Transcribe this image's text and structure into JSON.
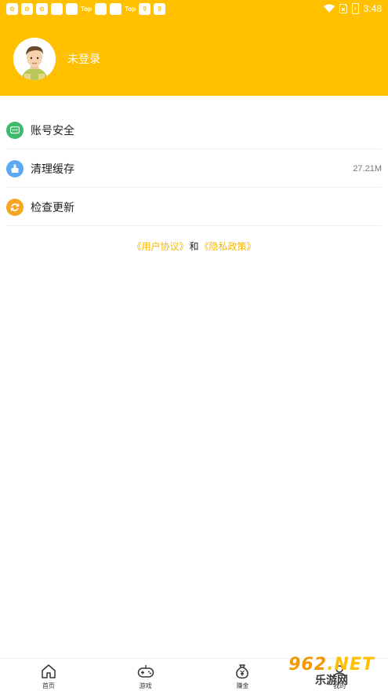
{
  "status_bar": {
    "top_label_1": "Top",
    "top_label_2": "Top",
    "time": "3:48",
    "battery": "⚡"
  },
  "profile": {
    "login_status": "未登录"
  },
  "menu": {
    "items": [
      {
        "label": "账号安全",
        "value": "",
        "icon": "chat-icon",
        "color": "#3DBB6B"
      },
      {
        "label": "清理缓存",
        "value": "27.21M",
        "icon": "clean-icon",
        "color": "#5AA9F2"
      },
      {
        "label": "检查更新",
        "value": "",
        "icon": "refresh-icon",
        "color": "#F5A623"
      }
    ]
  },
  "agreement": {
    "user_agreement": "《用户协议》",
    "and": "和",
    "privacy_policy": "《隐私政策》"
  },
  "tabbar": {
    "tabs": [
      {
        "label": "首页",
        "icon": "home-icon"
      },
      {
        "label": "游戏",
        "icon": "gamepad-icon"
      },
      {
        "label": "赚金",
        "icon": "money-bag-icon"
      },
      {
        "label": "我的",
        "icon": "user-icon"
      }
    ]
  },
  "watermark": {
    "brand": "962",
    "suffix": ".NET",
    "name": "乐游网"
  },
  "colors": {
    "accent": "#FFC000",
    "link": "#F5B800"
  }
}
